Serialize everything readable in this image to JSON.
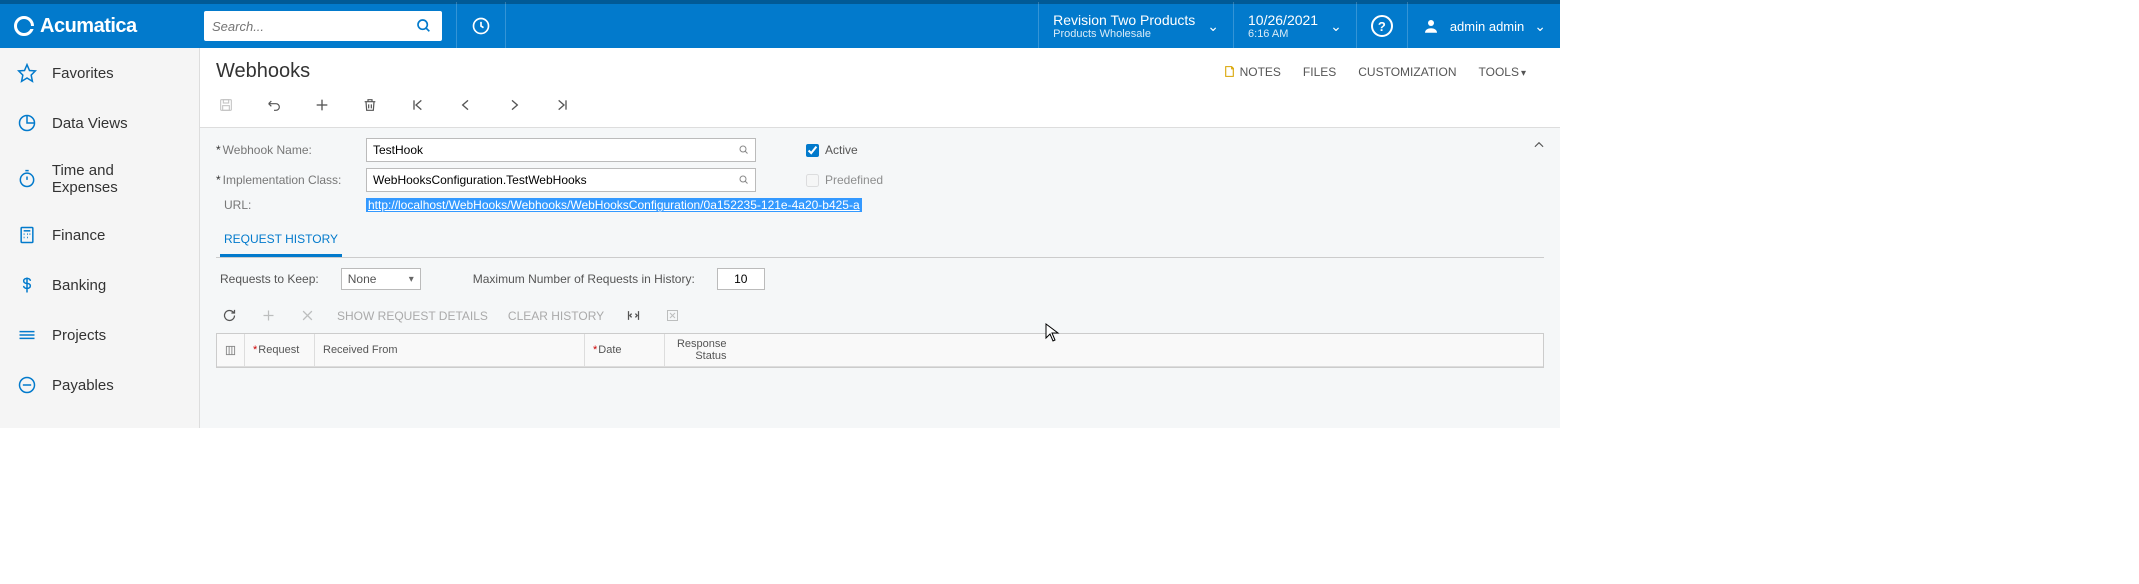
{
  "brand": "Acumatica",
  "search": {
    "placeholder": "Search..."
  },
  "tenant": {
    "name": "Revision Two Products",
    "sub": "Products Wholesale"
  },
  "datetime": {
    "date": "10/26/2021",
    "time": "6:16 AM"
  },
  "user": {
    "name": "admin admin"
  },
  "sidebar": {
    "items": [
      {
        "label": "Favorites"
      },
      {
        "label": "Data Views"
      },
      {
        "label": "Time and Expenses"
      },
      {
        "label": "Finance"
      },
      {
        "label": "Banking"
      },
      {
        "label": "Projects"
      },
      {
        "label": "Payables"
      }
    ]
  },
  "page": {
    "title": "Webhooks"
  },
  "topLinks": {
    "notes": "NOTES",
    "files": "FILES",
    "customization": "CUSTOMIZATION",
    "tools": "TOOLS"
  },
  "form": {
    "webhookNameLabel": "Webhook Name:",
    "webhookNameValue": "TestHook",
    "implClassLabel": "Implementation Class:",
    "implClassValue": "WebHooksConfiguration.TestWebHooks",
    "urlLabel": "URL:",
    "urlValue": "http://localhost/WebHooks/Webhooks/WebHooksConfiguration/0a152235-121e-4a20-b425-a",
    "activeLabel": "Active",
    "activeChecked": true,
    "predefinedLabel": "Predefined",
    "predefinedChecked": false
  },
  "tabs": {
    "requestHistory": "REQUEST HISTORY"
  },
  "history": {
    "requestsToKeepLabel": "Requests to Keep:",
    "requestsToKeepValue": "None",
    "maxNumLabel": "Maximum Number of Requests in History:",
    "maxNumValue": "10",
    "showDetails": "SHOW REQUEST DETAILS",
    "clearHistory": "CLEAR HISTORY"
  },
  "gridCols": {
    "request": "Request",
    "receivedFrom": "Received From",
    "date": "Date",
    "responseStatus": "Response Status"
  }
}
